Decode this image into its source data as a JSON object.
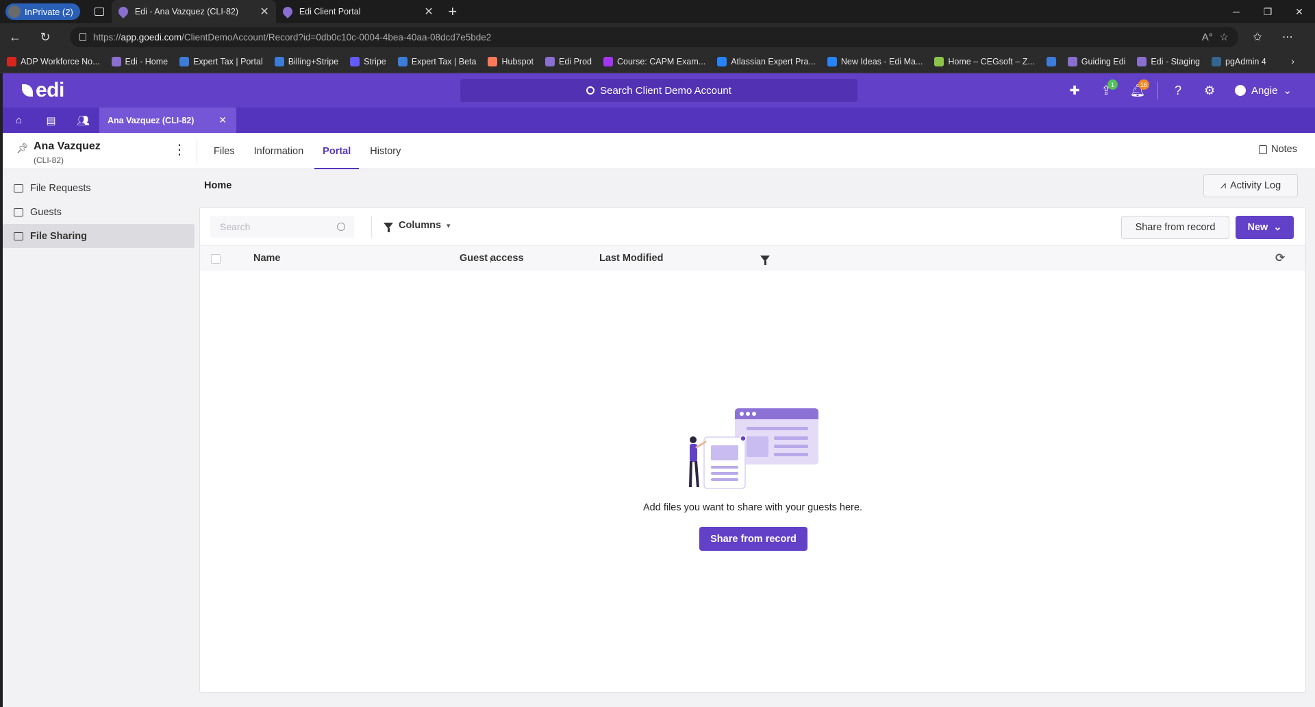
{
  "browser": {
    "inprivate_label": "InPrivate (2)",
    "tabs": [
      {
        "label": "Edi - Ana Vazquez (CLI-82)"
      },
      {
        "label": "Edi Client Portal"
      }
    ],
    "url_domain": "app.goedi.com",
    "url_prefix": "https://",
    "url_path": "/ClientDemoAccount/Record?id=0db0c10c-0004-4bea-40aa-08dcd7e5bde2",
    "bookmarks": [
      {
        "label": "ADP Workforce No...",
        "color": "#d8261f"
      },
      {
        "label": "Edi - Home",
        "color": "#8a6fd0"
      },
      {
        "label": "Expert Tax | Portal",
        "color": "#3b7dd8"
      },
      {
        "label": "Billing+Stripe",
        "color": "#3b7dd8"
      },
      {
        "label": "Stripe",
        "color": "#635bff"
      },
      {
        "label": "Expert Tax | Beta",
        "color": "#3b7dd8"
      },
      {
        "label": "Hubspot",
        "color": "#ff7a59"
      },
      {
        "label": "Edi Prod",
        "color": "#8a6fd0"
      },
      {
        "label": "Course: CAPM Exam...",
        "color": "#a435f0"
      },
      {
        "label": "Atlassian Expert Pra...",
        "color": "#2684ff"
      },
      {
        "label": "New Ideas - Edi Ma...",
        "color": "#2684ff"
      },
      {
        "label": "Home – CEGsoft – Z...",
        "color": "#8bc34a"
      },
      {
        "label": "",
        "color": "#3b7dd8"
      },
      {
        "label": "Guiding Edi",
        "color": "#8a6fd0"
      },
      {
        "label": "Edi - Staging",
        "color": "#8a6fd0"
      },
      {
        "label": "pgAdmin 4",
        "color": "#336791"
      }
    ]
  },
  "app": {
    "logo": "edi",
    "search_label": "Search Client Demo Account",
    "badges": {
      "upload": "1",
      "notifications": "16"
    },
    "user_name": "Angie",
    "record_tab_label": "Ana Vazquez (CLI-82)",
    "colors": {
      "brand": "#6340c8",
      "brand_dark": "#5534bd"
    }
  },
  "record": {
    "name": "Ana Vazquez",
    "id": "(CLI-82)",
    "tabs": [
      {
        "label": "Files"
      },
      {
        "label": "Information"
      },
      {
        "label": "Portal"
      },
      {
        "label": "History"
      }
    ],
    "active_tab": "Portal",
    "notes_label": "Notes"
  },
  "sidebar": {
    "items": [
      {
        "label": "File Requests",
        "icon": "envelope-icon"
      },
      {
        "label": "Guests",
        "icon": "contact-icon"
      },
      {
        "label": "File Sharing",
        "icon": "file-share-icon"
      }
    ],
    "active_item": "File Sharing"
  },
  "main": {
    "breadcrumb": "Home",
    "activity_log_label": "Activity Log",
    "search_placeholder": "Search",
    "columns_label": "Columns",
    "share_label": "Share from record",
    "new_label": "New",
    "table_headers": {
      "name": "Name",
      "guest_access": "Guest access",
      "last_modified": "Last Modified"
    },
    "empty_text": "Add files you want to share with your guests here.",
    "empty_button": "Share from record"
  }
}
